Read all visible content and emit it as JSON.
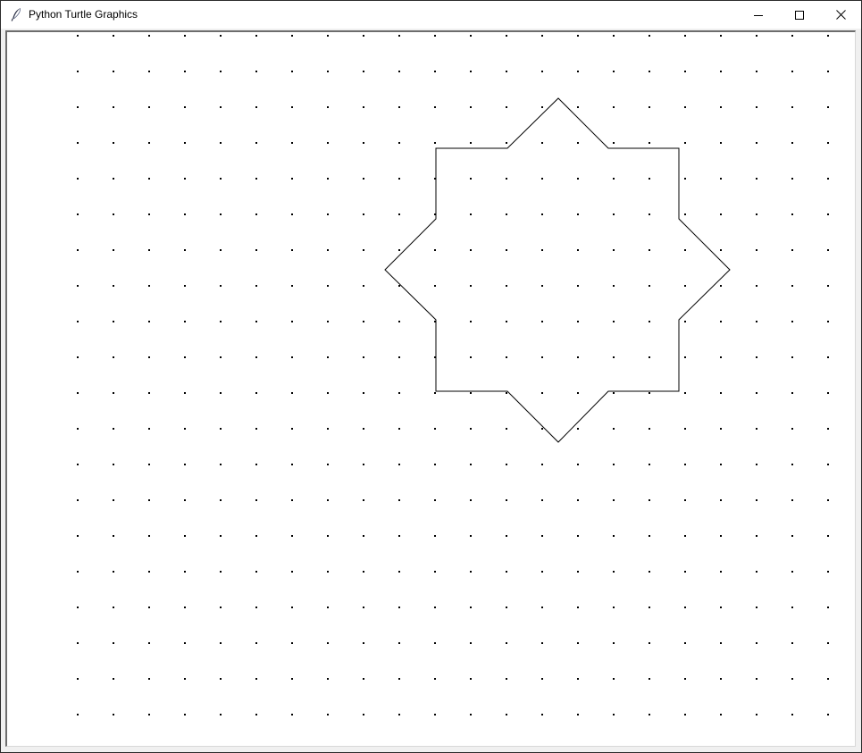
{
  "window": {
    "title": "Python Turtle Graphics",
    "app_icon": "feather-icon",
    "controls": [
      "minimize-icon",
      "maximize-icon",
      "close-icon"
    ]
  },
  "canvas": {
    "background_color": "#ffffff",
    "dot_color": "#000000",
    "pen_color": "#000000"
  }
}
